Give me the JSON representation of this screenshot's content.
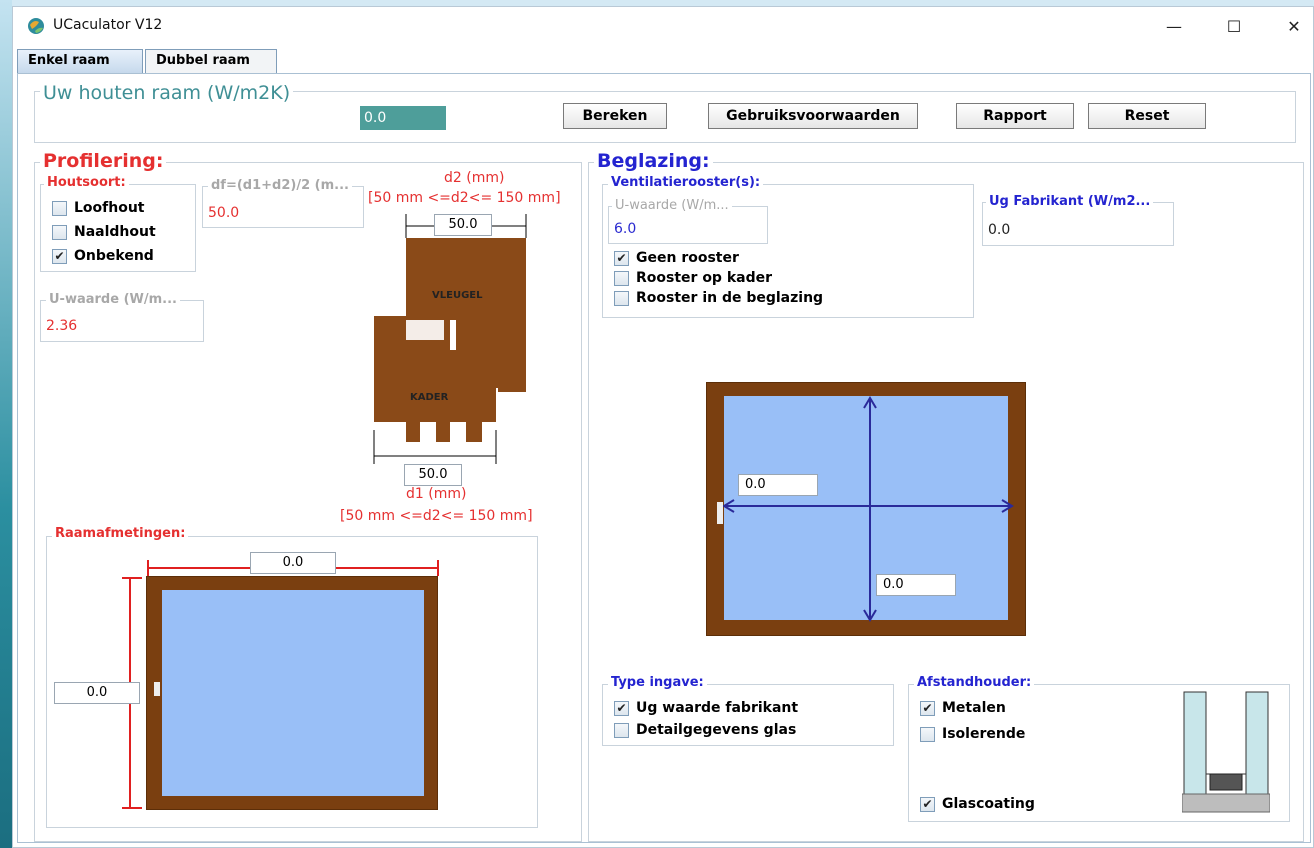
{
  "window": {
    "title": "UCaculator V12",
    "controls": {
      "minimize": "—",
      "maximize": "☐",
      "close": "✕"
    }
  },
  "tabs": [
    {
      "label": "Enkel raam",
      "selected": true
    },
    {
      "label": "Dubbel raam",
      "selected": false
    }
  ],
  "header": {
    "group_title": "Uw houten raam (W/m2K)",
    "result_value": "0.0",
    "buttons": {
      "calculate": "Bereken",
      "terms": "Gebruiksvoorwaarden",
      "report": "Rapport",
      "reset": "Reset"
    }
  },
  "profilering": {
    "title": "Profilering:",
    "houtsoort": {
      "title": "Houtsoort:",
      "options": [
        {
          "label": "Loofhout",
          "checked": false
        },
        {
          "label": "Naaldhout",
          "checked": false
        },
        {
          "label": "Onbekend",
          "checked": true
        }
      ]
    },
    "df": {
      "title": "df=(d1+d2)/2 (m...",
      "value": "50.0"
    },
    "u_waarde": {
      "title": "U-waarde (W/m...",
      "value": "2.36"
    },
    "d2": {
      "label": "d2 (mm)",
      "range": "[50 mm <=d2<= 150 mm]",
      "value": "50.0"
    },
    "d1": {
      "label": "d1 (mm)",
      "range": "[50 mm <=d2<= 150 mm]",
      "value": "50.0"
    },
    "profile_labels": {
      "sash": "VLEUGEL",
      "frame": "KADER"
    }
  },
  "raamafmetingen": {
    "title": "Raamafmetingen:",
    "width": "0.0",
    "height": "0.0"
  },
  "beglazing": {
    "title": "Beglazing:",
    "ventilatie": {
      "title": "Ventilatierooster(s):",
      "u_label": "U-waarde (W/m...",
      "u_value": "6.0",
      "options": [
        {
          "label": "Geen rooster",
          "checked": true
        },
        {
          "label": "Rooster op kader",
          "checked": false
        },
        {
          "label": "Rooster in de beglazing",
          "checked": false
        }
      ]
    },
    "ug_fabrikant": {
      "title": "Ug Fabrikant (W/m2...",
      "value": "0.0"
    },
    "glass_width": "0.0",
    "glass_height": "0.0",
    "type_ingave": {
      "title": "Type ingave:",
      "options": [
        {
          "label": "Ug waarde fabrikant",
          "checked": true
        },
        {
          "label": "Detailgegevens glas",
          "checked": false
        }
      ]
    },
    "afstandhouder": {
      "title": "Afstandhouder:",
      "options": [
        {
          "label": "Metalen",
          "checked": true
        },
        {
          "label": "Isolerende",
          "checked": false
        },
        {
          "label": "Glascoating",
          "checked": true
        }
      ]
    }
  },
  "colors": {
    "wood": "#7a3f10",
    "glass": "#99bff7",
    "red_label": "#e53030",
    "blue_label": "#2424d0",
    "result_bg": "#4e9e9a"
  }
}
